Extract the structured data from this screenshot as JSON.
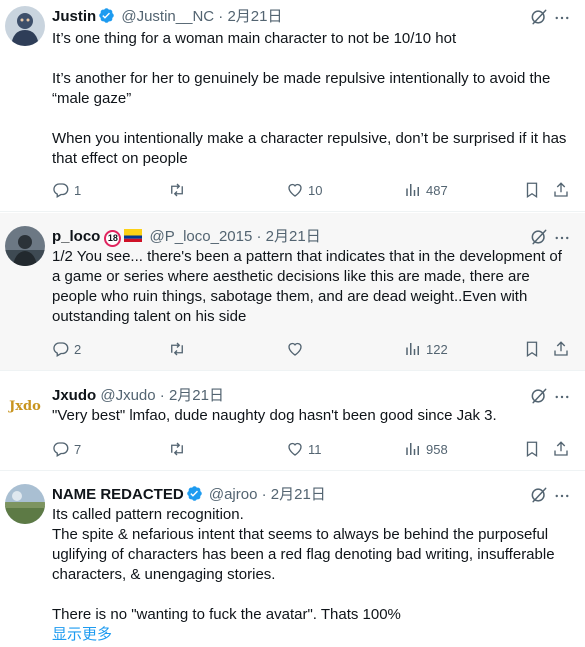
{
  "tweets": [
    {
      "name": "Justin",
      "verified": true,
      "handle": "@Justin__NC",
      "sep": "·",
      "date": "2月21日",
      "lines": [
        "It’s one thing for a woman main character to not be 10/10 hot",
        "",
        "It’s another for her to genuinely be made repulsive intentionally to avoid the “male gaze”",
        "",
        "When you intentionally make a character repulsive, don’t be surprised if it has that effect on people"
      ],
      "replies": "1",
      "retweets": "",
      "likes": "10",
      "views": "487"
    },
    {
      "name": "p_loco",
      "badge": "18",
      "handle": "@P_loco_2015",
      "sep": "·",
      "date": "2月21日",
      "lines": [
        "1/2 You see... there's been a pattern that indicates that in the development of a game or series where aesthetic decisions like this are made, there are people who ruin things, sabotage them, and are dead weight..Even with outstanding talent on his side"
      ],
      "replies": "2",
      "retweets": "",
      "likes": "",
      "views": "122"
    },
    {
      "name": "Jxudo",
      "handle": "@Jxudo",
      "sep": "·",
      "date": "2月21日",
      "lines": [
        "\"Very best\" lmfao, dude naughty dog hasn't been good since Jak 3."
      ],
      "replies": "7",
      "retweets": "",
      "likes": "11",
      "views": "958"
    },
    {
      "name": "NAME REDACTED",
      "verified": true,
      "handle": "@ajroo",
      "sep": "·",
      "date": "2月21日",
      "lines": [
        "Its called pattern recognition.",
        "The spite & nefarious intent that seems to always be behind the purposeful uglifying of characters has been a red flag denoting bad writing, insufferable characters, & unengaging stories.",
        "",
        "There is no \"wanting to fuck the avatar\". Thats 100%"
      ],
      "show_more": "显示更多"
    }
  ],
  "colors": {
    "accent": "#1d9bf0",
    "muted": "#536471",
    "text": "#0f1419"
  }
}
